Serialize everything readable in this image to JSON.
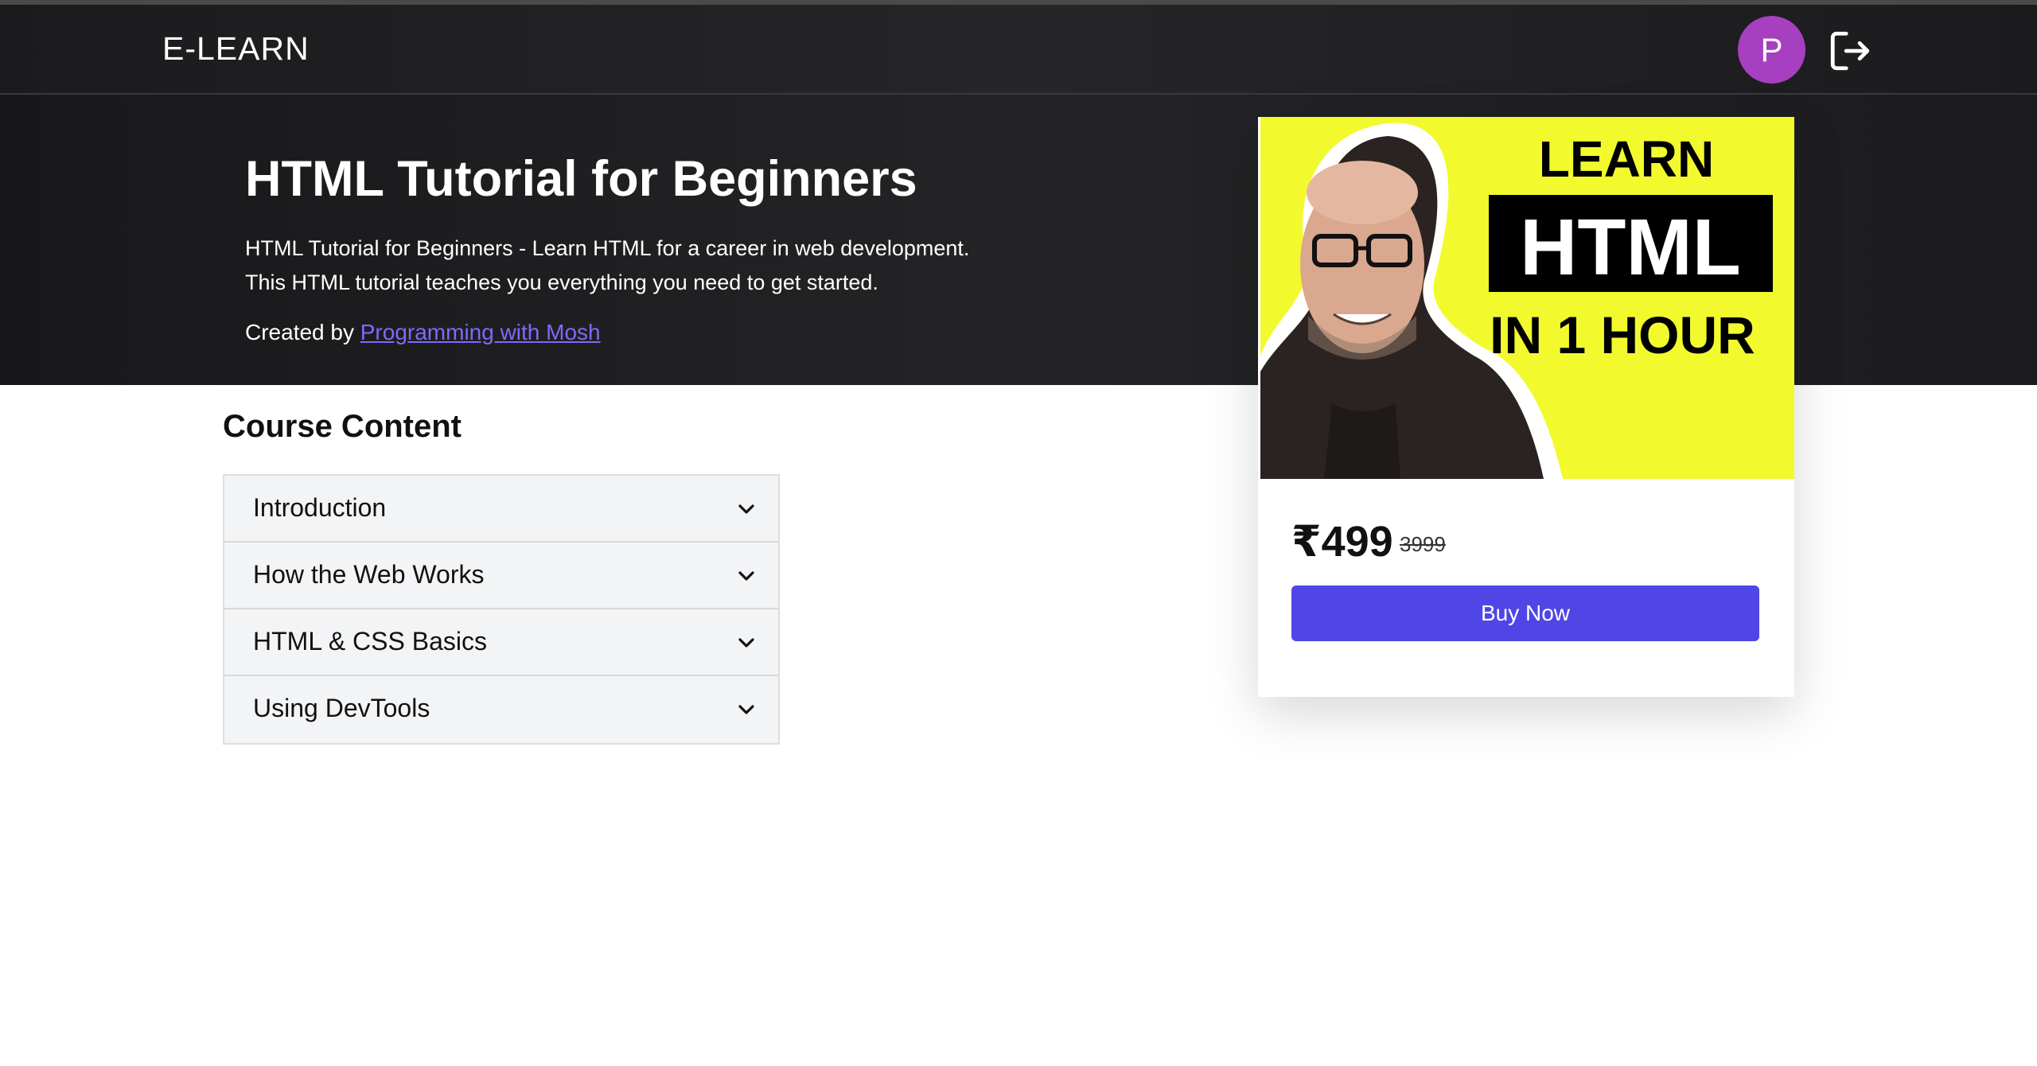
{
  "app": {
    "brand": "E-LEARN",
    "user_initial": "P"
  },
  "course": {
    "title": "HTML Tutorial for Beginners",
    "description_lines": [
      "HTML Tutorial for Beginners - Learn HTML for a career in web development.",
      "This HTML tutorial teaches you everything you need to get started."
    ],
    "created_by_label": "Created by",
    "author": "Programming with Mosh"
  },
  "content": {
    "heading": "Course Content",
    "sections": [
      {
        "label": "Introduction"
      },
      {
        "label": "How the Web Works"
      },
      {
        "label": "HTML & CSS Basics"
      },
      {
        "label": "Using DevTools"
      }
    ]
  },
  "card": {
    "thumb_line1": "LEARN",
    "thumb_line2": "HTML",
    "thumb_line3": "IN 1 HOUR",
    "price": "₹499",
    "old_price": "3999",
    "buy_label": "Buy Now"
  },
  "colors": {
    "accent": "#4f46e5",
    "avatar": "#a73fc1",
    "link": "#7b6bff",
    "thumb_bg": "#f2fa2e"
  },
  "icons": [
    "logout-icon",
    "chevron-down-icon"
  ]
}
